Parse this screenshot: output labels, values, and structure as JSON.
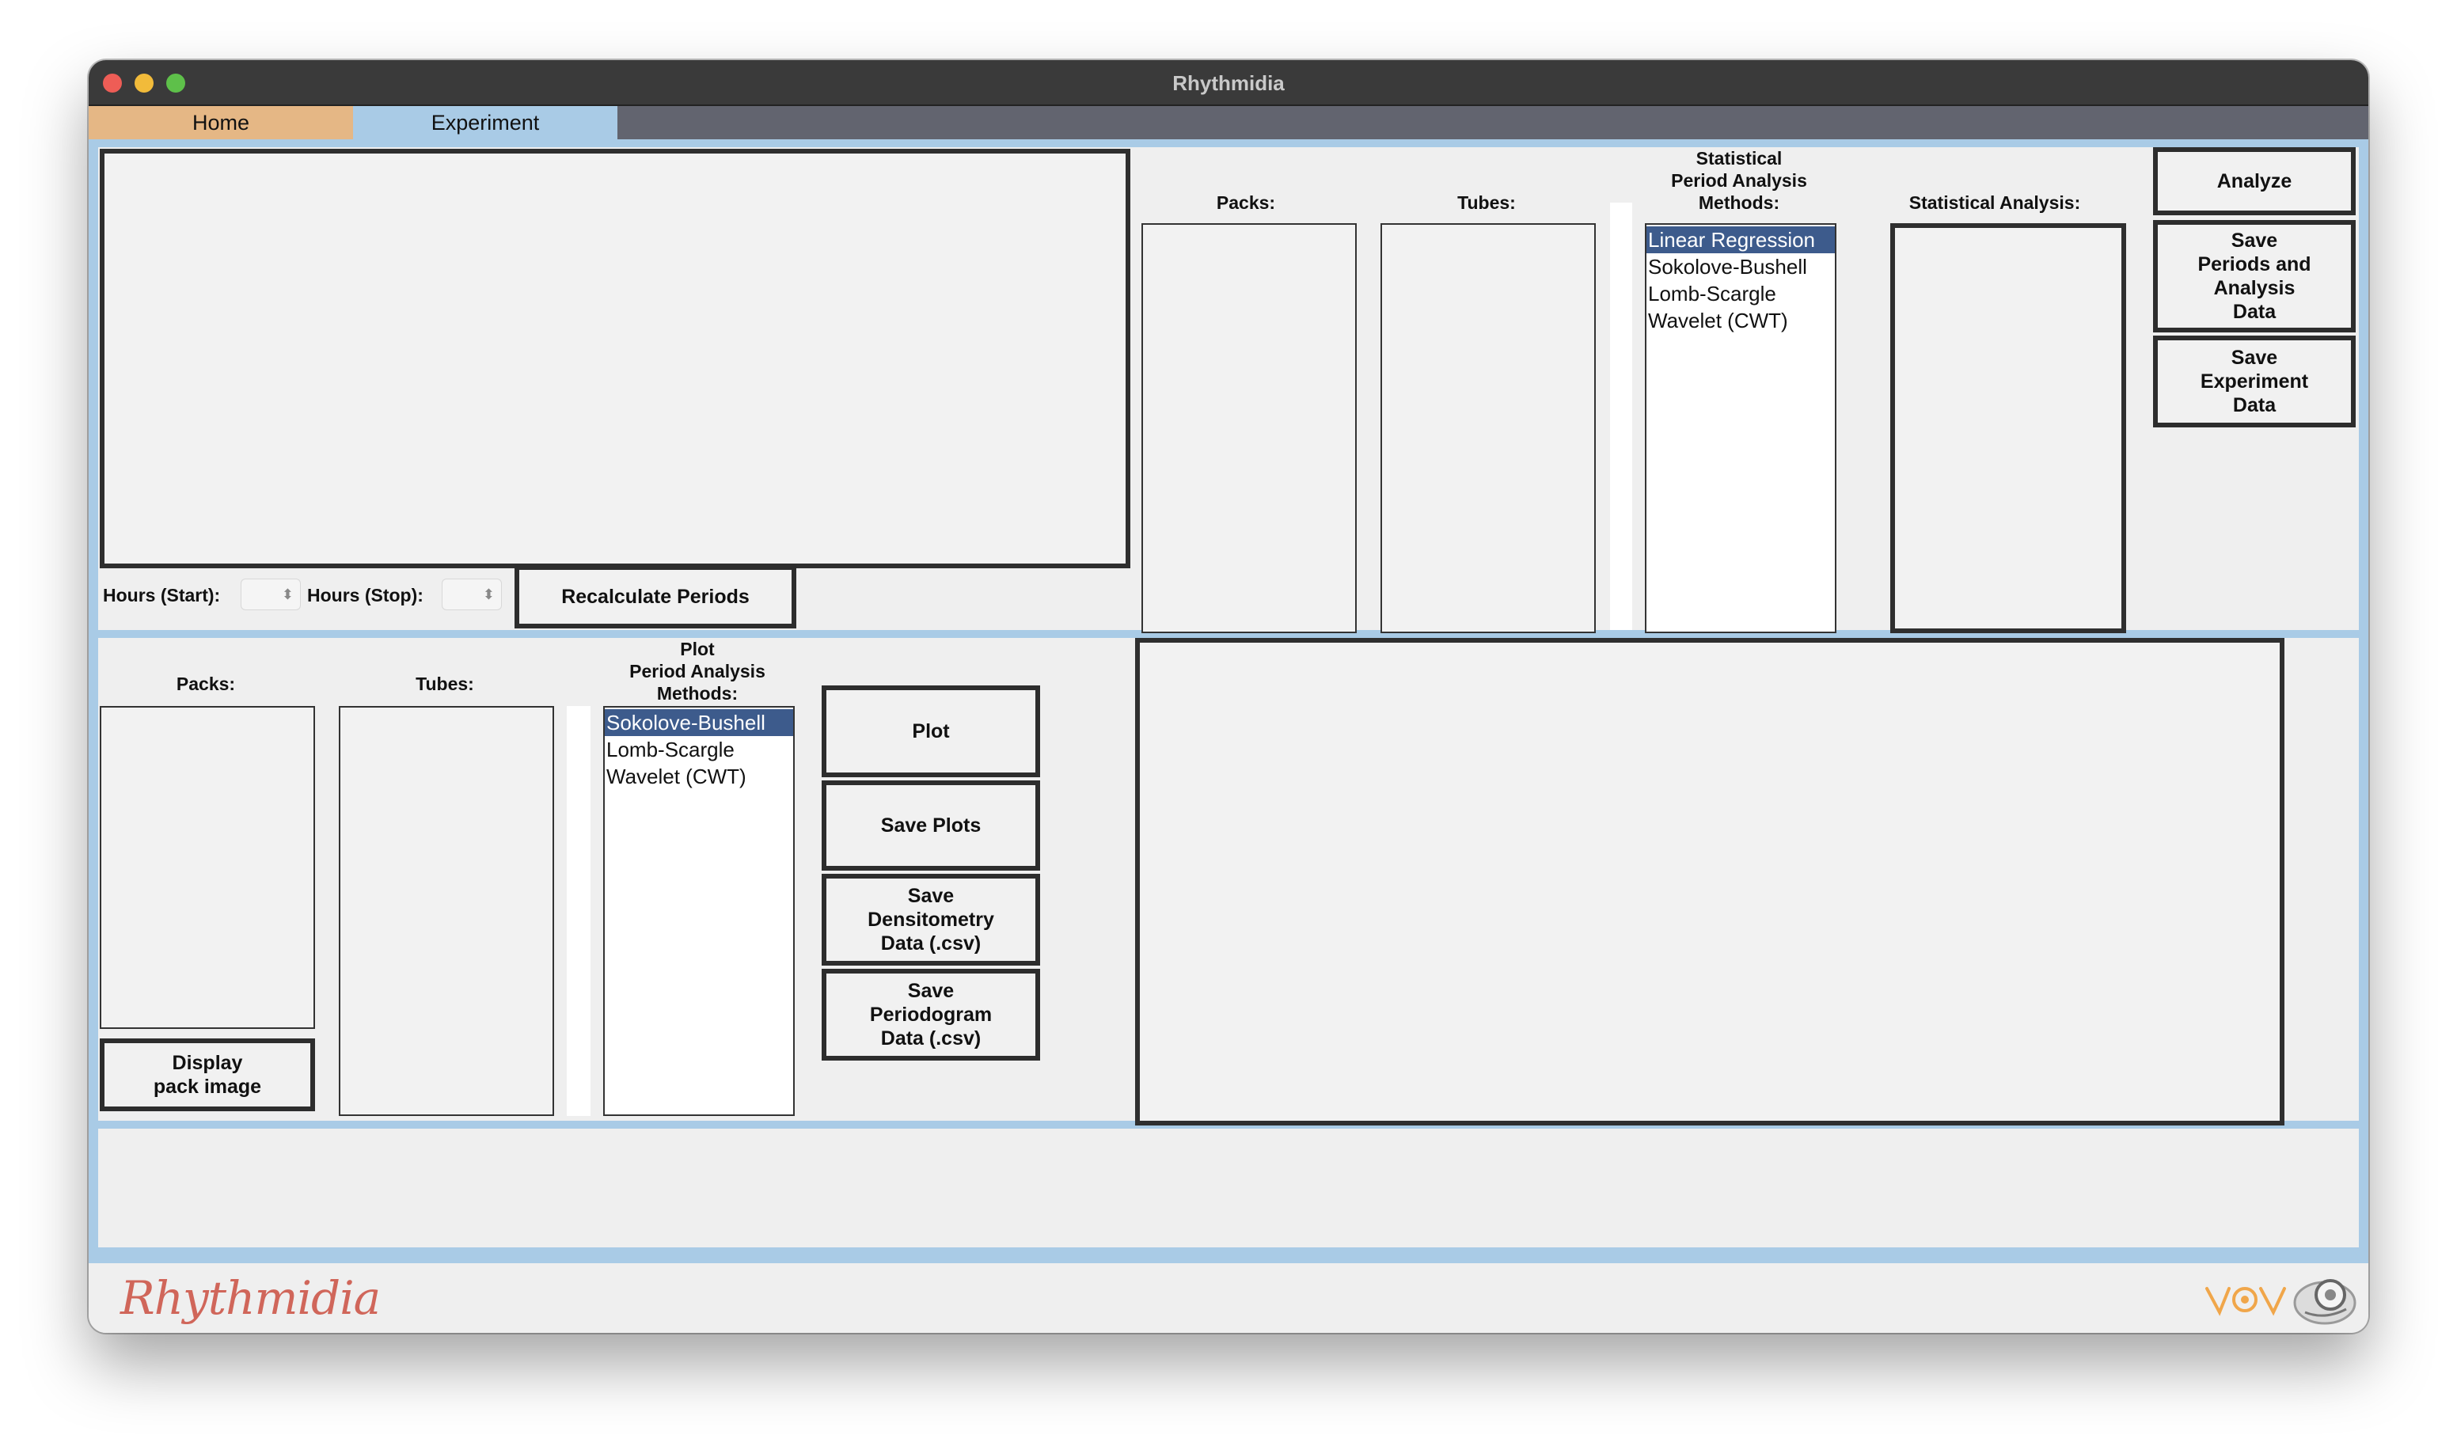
{
  "window": {
    "title": "Rhythmidia"
  },
  "tabs": [
    {
      "label": "Home",
      "color": "#e5b785"
    },
    {
      "label": "Experiment",
      "color": "#a9cbe6"
    }
  ],
  "analysis": {
    "hours_start_label": "Hours (Start):",
    "hours_stop_label": "Hours (Stop):",
    "hours_start_value": "",
    "hours_stop_value": "",
    "recalculate_button": "Recalculate Periods",
    "packs_label": "Packs:",
    "tubes_label": "Tubes:",
    "methods_label": [
      "Statistical",
      "Period Analysis",
      "Methods:"
    ],
    "methods": [
      "Linear Regression",
      "Sokolove-Bushell",
      "Lomb-Scargle",
      "Wavelet (CWT)"
    ],
    "methods_selected": "Linear Regression",
    "stat_analysis_label": "Statistical Analysis:",
    "analyze_button": "Analyze",
    "save_periods_button": [
      "Save",
      "Periods and",
      "Analysis",
      "Data"
    ],
    "save_experiment_button": [
      "Save",
      "Experiment",
      "Data"
    ]
  },
  "plotting": {
    "packs_label": "Packs:",
    "tubes_label": "Tubes:",
    "methods_label": [
      "Plot",
      "Period Analysis",
      "Methods:"
    ],
    "methods": [
      "Sokolove-Bushell",
      "Lomb-Scargle",
      "Wavelet (CWT)"
    ],
    "methods_selected": "Sokolove-Bushell",
    "display_pack_button": [
      "Display",
      "pack image"
    ],
    "plot_button": "Plot",
    "save_plots_button": "Save Plots",
    "save_densitometry_button": [
      "Save",
      "Densitometry",
      "Data (.csv)"
    ],
    "save_periodogram_button": [
      "Save",
      "Periodogram",
      "Data (.csv)"
    ]
  },
  "footer": {
    "logo_text": "Rhythmidia"
  },
  "colors": {
    "accent_blue": "#a9cbe6",
    "home_tab": "#e5b785",
    "selection": "#3d5b8c",
    "logo": "#d0665a"
  }
}
